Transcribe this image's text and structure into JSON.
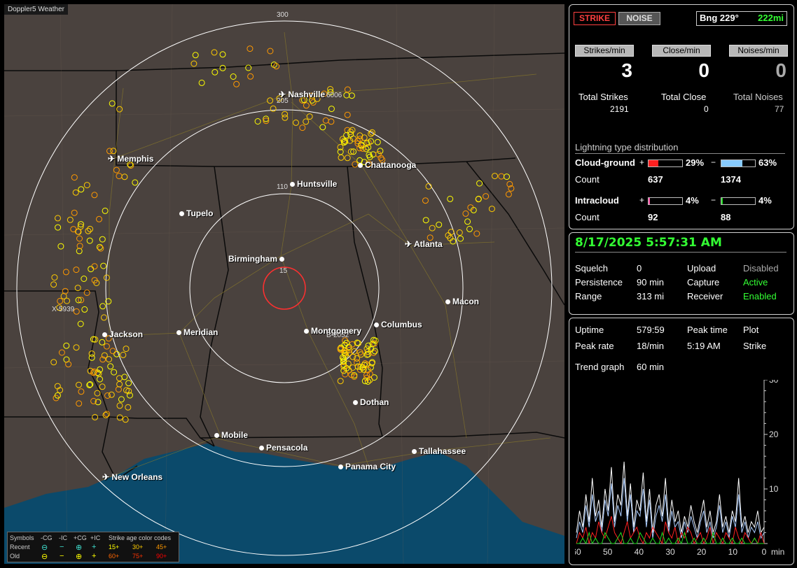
{
  "map": {
    "title": "Doppler5 Weather",
    "ring_labels": [
      "300",
      "205",
      "110",
      "15"
    ],
    "cities": [
      {
        "name": "Nashville",
        "airport": true
      },
      {
        "name": "Memphis",
        "airport": true
      },
      {
        "name": "Chattanooga",
        "airport": false
      },
      {
        "name": "Huntsville",
        "airport": false
      },
      {
        "name": "Tupelo",
        "airport": false
      },
      {
        "name": "Atlanta",
        "airport": true
      },
      {
        "name": "Birmingham",
        "airport": false
      },
      {
        "name": "Macon",
        "airport": false
      },
      {
        "name": "Jackson",
        "airport": false
      },
      {
        "name": "Meridian",
        "airport": false
      },
      {
        "name": "Montgomery",
        "airport": false
      },
      {
        "name": "Columbus",
        "airport": false
      },
      {
        "name": "Dothan",
        "airport": false
      },
      {
        "name": "Mobile",
        "airport": false
      },
      {
        "name": "Pensacola",
        "airport": false
      },
      {
        "name": "Tallahassee",
        "airport": false
      },
      {
        "name": "Panama City",
        "airport": false
      },
      {
        "name": "New Orleans",
        "airport": true
      }
    ],
    "cell_labels": [
      "6006",
      "X-5939",
      "B-2052"
    ],
    "legend": {
      "row_header": "Symbols",
      "columns": [
        "-CG",
        "-IC",
        "+CG",
        "+IC"
      ],
      "rows": [
        {
          "label": "Recent",
          "symbols": [
            "⊖",
            "−",
            "⊕",
            "+"
          ]
        },
        {
          "label": "Old",
          "symbols": [
            "⊖",
            "−",
            "⊕",
            "+"
          ]
        }
      ],
      "age_title": "Strike age color codes",
      "age_recent": [
        "15+",
        "30+",
        "45+"
      ],
      "age_old": [
        "60+",
        "75+",
        "90+"
      ],
      "age_colors": [
        "#ffff00",
        "#ffcc00",
        "#ff9900",
        "#ff6600",
        "#ff3300",
        "#ff0000"
      ]
    }
  },
  "stats": {
    "strike_btn": "STRIKE",
    "noise_btn": "NOISE",
    "bearing_label": "Bng 229°",
    "bearing_distance": "222mi",
    "headers": [
      "Strikes/min",
      "Close/min",
      "Noises/min"
    ],
    "rates": [
      "3",
      "0",
      "0"
    ],
    "totals_labels": [
      "Total Strikes",
      "Total Close",
      "Total Noises"
    ],
    "totals": [
      "2191",
      "0",
      "77"
    ],
    "distribution_title": "Lightning type distribution",
    "cg_label": "Cloud-ground",
    "ic_label": "Intracloud",
    "plus": "+",
    "minus": "−",
    "count_label": "Count",
    "cg_pos_pct": "29%",
    "cg_neg_pct": "63%",
    "ic_pos_pct": "4%",
    "ic_neg_pct": "4%",
    "cg_pos_frac": 0.29,
    "cg_neg_frac": 0.63,
    "ic_pos_frac": 0.04,
    "ic_neg_frac": 0.04,
    "cg_pos_count": "637",
    "cg_neg_count": "1374",
    "ic_pos_count": "92",
    "ic_neg_count": "88"
  },
  "status": {
    "datetime": "8/17/2025 5:57:31 AM",
    "squelch_label": "Squelch",
    "squelch": "0",
    "persistence_label": "Persistence",
    "persistence": "90 min",
    "range_label": "Range",
    "range": "313 mi",
    "upload_label": "Upload",
    "upload": "Disabled",
    "capture_label": "Capture",
    "capture": "Active",
    "receiver_label": "Receiver",
    "receiver": "Enabled"
  },
  "trend": {
    "uptime_label": "Uptime",
    "uptime": "579:59",
    "peak_time_label": "Peak time",
    "plot_label": "Plot",
    "peak_rate_label": "Peak rate",
    "peak_rate": "18/min",
    "peak_time": "5:19 AM",
    "plot": "Strike",
    "trend_label": "Trend graph",
    "trend_window": "60 min",
    "y_ticks": [
      "30",
      "20",
      "10"
    ],
    "x_ticks": [
      "60",
      "50",
      "40",
      "30",
      "20",
      "10",
      "0"
    ],
    "x_unit": "min"
  },
  "chart_data": {
    "type": "line",
    "title": "",
    "xlabel": "min",
    "ylabel": "",
    "xlim": [
      60,
      0
    ],
    "ylim": [
      0,
      30
    ],
    "series": [
      {
        "color": "#ffffff",
        "values": [
          2,
          6,
          3,
          9,
          4,
          12,
          5,
          8,
          3,
          10,
          6,
          14,
          4,
          9,
          7,
          15,
          5,
          11,
          3,
          8,
          6,
          13,
          4,
          10,
          2,
          7,
          9,
          5,
          12,
          3,
          8,
          4,
          6,
          2,
          5,
          3,
          7,
          4,
          2,
          5,
          8,
          3,
          6,
          2,
          4,
          9,
          3,
          5,
          2,
          6,
          4,
          12,
          3,
          5,
          2,
          4,
          3,
          6,
          2,
          3
        ]
      },
      {
        "color": "#aaccff",
        "values": [
          1,
          4,
          2,
          7,
          3,
          9,
          4,
          6,
          2,
          8,
          5,
          11,
          3,
          7,
          5,
          12,
          4,
          9,
          2,
          6,
          5,
          10,
          3,
          8,
          1,
          5,
          7,
          4,
          9,
          2,
          6,
          3,
          4,
          1,
          4,
          2,
          5,
          3,
          1,
          4,
          6,
          2,
          4,
          1,
          3,
          7,
          2,
          4,
          1,
          5,
          3,
          9,
          2,
          4,
          1,
          3,
          2,
          4,
          1,
          2
        ]
      },
      {
        "color": "#ff2020",
        "values": [
          0,
          2,
          1,
          3,
          0,
          2,
          1,
          4,
          2,
          1,
          3,
          5,
          2,
          1,
          0,
          2,
          4,
          1,
          2,
          3,
          1,
          0,
          2,
          1,
          3,
          2,
          1,
          0,
          4,
          2,
          1,
          3,
          0,
          2,
          1,
          3,
          2,
          0,
          1,
          2,
          0,
          1,
          3,
          0,
          2,
          1,
          0,
          2,
          1,
          0,
          3,
          1,
          0,
          2,
          1,
          0,
          1,
          0,
          2,
          0
        ]
      },
      {
        "color": "#20dd20",
        "values": [
          0,
          0,
          1,
          0,
          2,
          0,
          1,
          0,
          0,
          2,
          1,
          0,
          0,
          1,
          2,
          0,
          0,
          1,
          0,
          0,
          2,
          1,
          0,
          0,
          1,
          0,
          0,
          2,
          0,
          1,
          0,
          0,
          1,
          0,
          2,
          0,
          0,
          1,
          0,
          0,
          1,
          0,
          0,
          2,
          0,
          0,
          1,
          0,
          0,
          1,
          0,
          0,
          1,
          0,
          0,
          0,
          1,
          0,
          0,
          0
        ]
      }
    ]
  }
}
